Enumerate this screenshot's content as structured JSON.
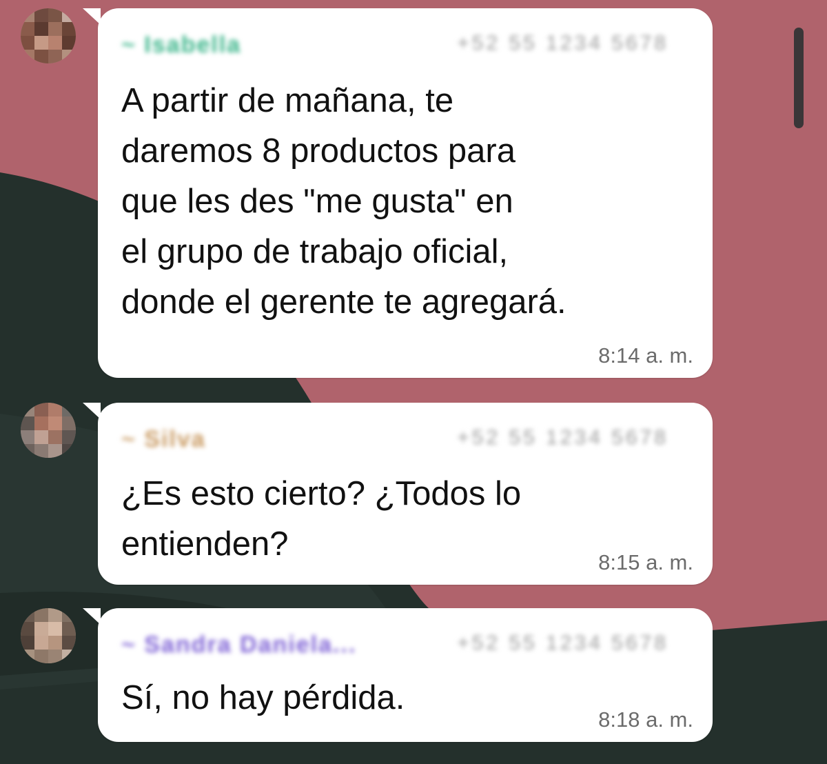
{
  "messages": [
    {
      "sender": "~ Isabella",
      "phone": "+52 55 1234 5678",
      "name_color": "#3bb58a",
      "text": "A partir de mañana, te\ndaremos 8 productos para\nque les des \"me gusta\" en\nel grupo de trabajo oficial,\ndonde el gerente te agregará.",
      "time": "8:14 a. m."
    },
    {
      "sender": "~ Silva",
      "phone": "+52 55 1234 5678",
      "name_color": "#c99a62",
      "text": "¿Es esto cierto? ¿Todos lo\nentienden?",
      "time": "8:15 a. m."
    },
    {
      "sender": "~ Sandra Daniela...",
      "phone": "+52 55 1234 5678",
      "name_color": "#7f63d6",
      "text": "Sí, no hay pérdida.",
      "time": "8:18 a. m."
    }
  ],
  "colors": {
    "background": "#b0636c",
    "dark_shape": "#24302c",
    "bubble": "#ffffff",
    "scrollbar": "#3a3638"
  },
  "icons": {
    "avatar": "contact-avatar-icon",
    "scroll": "scrollbar-thumb"
  }
}
